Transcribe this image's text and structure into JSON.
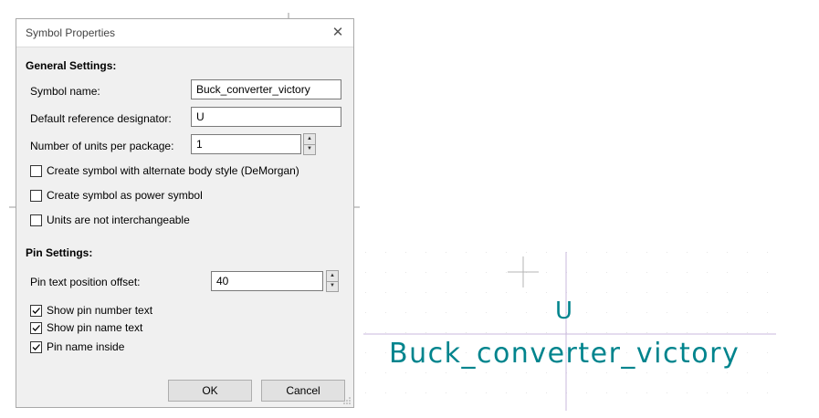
{
  "dialog": {
    "title": "Symbol Properties",
    "close_glyph": "✕",
    "general_heading": "General Settings:",
    "symbol_name_label": "Symbol name:",
    "symbol_name_value": "Buck_converter_victory",
    "ref_designator_label": "Default reference designator:",
    "ref_designator_value": "U",
    "units_label": "Number of units per package:",
    "units_value": "1",
    "checkboxes_general": [
      {
        "label": "Create symbol with alternate body style (DeMorgan)",
        "checked": false
      },
      {
        "label": "Create symbol as power symbol",
        "checked": false
      },
      {
        "label": "Units are not interchangeable",
        "checked": false
      }
    ],
    "pin_heading": "Pin Settings:",
    "pin_offset_label": "Pin text position offset:",
    "pin_offset_value": "40",
    "checkboxes_pin": [
      {
        "label": "Show pin number text",
        "checked": true
      },
      {
        "label": "Show pin name text",
        "checked": true
      },
      {
        "label": "Pin name inside",
        "checked": true
      }
    ],
    "ok_label": "OK",
    "cancel_label": "Cancel"
  },
  "canvas": {
    "reference_text": "U",
    "value_text": "Buck_converter_victory",
    "symbol_text_color": "#00848d",
    "axis_color": "#c8b8dc",
    "grid_dot_color": "#e6e6e6",
    "cursor_color": "#b4b4b4"
  }
}
